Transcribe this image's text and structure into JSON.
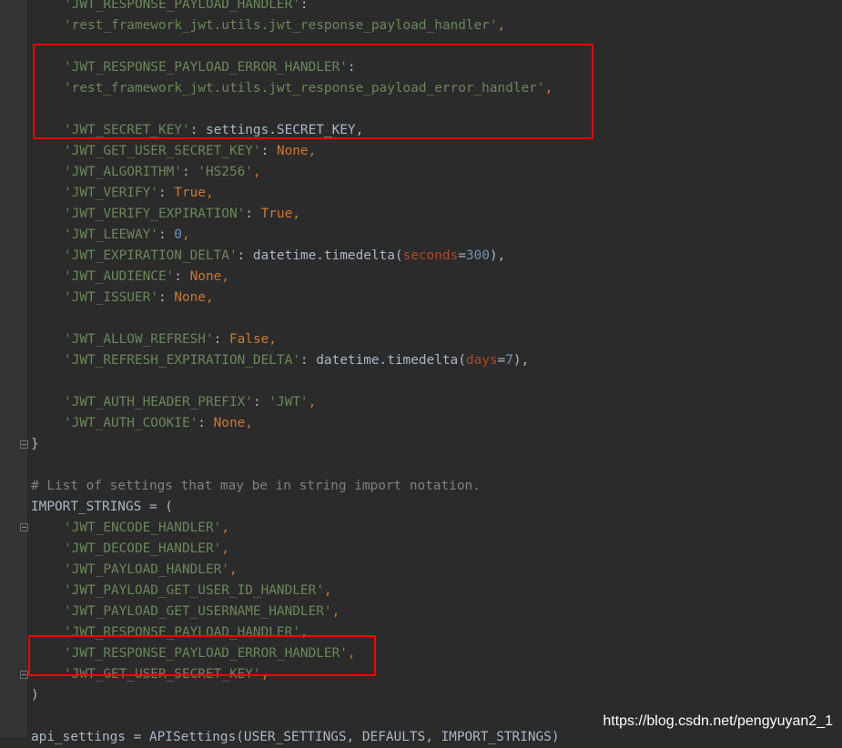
{
  "editor": {
    "colors": {
      "background": "#2b2b2b",
      "string": "#6a8759",
      "keyword": "#cc7832",
      "number": "#6897bb",
      "text": "#a9b7c6",
      "comment": "#808080",
      "param": "#aa4926",
      "highlight": "#ff0000"
    }
  },
  "code": {
    "l1": {
      "key": "'JWT_RESPONSE_PAYLOAD_HANDLER'",
      "rest": ":"
    },
    "l2": {
      "val": "'rest_framework_jwt.utils.jwt_response_payload_handler'",
      "rest": ","
    },
    "l4": {
      "key": "'JWT_RESPONSE_PAYLOAD_ERROR_HANDLER'",
      "rest": ":"
    },
    "l5": {
      "val": "'rest_framework_jwt.utils.jwt_response_payload_error_handler'",
      "rest": ","
    },
    "l7": {
      "key": "'JWT_SECRET_KEY'",
      "rest": ": settings.SECRET_KEY,"
    },
    "l8": {
      "key": "'JWT_GET_USER_SECRET_KEY'",
      "colon": ": ",
      "val": "None",
      "comma": ","
    },
    "l9": {
      "key": "'JWT_ALGORITHM'",
      "colon": ": ",
      "val": "'HS256'",
      "comma": ","
    },
    "l10": {
      "key": "'JWT_VERIFY'",
      "colon": ": ",
      "val": "True",
      "comma": ","
    },
    "l11": {
      "key": "'JWT_VERIFY_EXPIRATION'",
      "colon": ": ",
      "val": "True",
      "comma": ","
    },
    "l12": {
      "key": "'JWT_LEEWAY'",
      "colon": ": ",
      "val": "0",
      "comma": ","
    },
    "l13": {
      "key": "'JWT_EXPIRATION_DELTA'",
      "pre": ": datetime.timedelta(",
      "param": "seconds",
      "eq": "=",
      "num": "300",
      "post": "),"
    },
    "l14": {
      "key": "'JWT_AUDIENCE'",
      "colon": ": ",
      "val": "None",
      "comma": ","
    },
    "l15": {
      "key": "'JWT_ISSUER'",
      "colon": ": ",
      "val": "None",
      "comma": ","
    },
    "l17": {
      "key": "'JWT_ALLOW_REFRESH'",
      "colon": ": ",
      "val": "False",
      "comma": ","
    },
    "l18": {
      "key": "'JWT_REFRESH_EXPIRATION_DELTA'",
      "pre": ": datetime.timedelta(",
      "param": "days",
      "eq": "=",
      "num": "7",
      "post": "),"
    },
    "l20": {
      "key": "'JWT_AUTH_HEADER_PREFIX'",
      "colon": ": ",
      "val": "'JWT'",
      "comma": ","
    },
    "l21": {
      "key": "'JWT_AUTH_COOKIE'",
      "colon": ": ",
      "val": "None",
      "comma": ","
    },
    "l22": {
      "text": "}"
    },
    "l24": {
      "text": "# List of settings that may be in string import notation."
    },
    "l25": {
      "text": "IMPORT_STRINGS = ("
    },
    "l26": {
      "val": "'JWT_ENCODE_HANDLER'",
      "comma": ","
    },
    "l27": {
      "val": "'JWT_DECODE_HANDLER'",
      "comma": ","
    },
    "l28": {
      "val": "'JWT_PAYLOAD_HANDLER'",
      "comma": ","
    },
    "l29": {
      "val": "'JWT_PAYLOAD_GET_USER_ID_HANDLER'",
      "comma": ","
    },
    "l30": {
      "val": "'JWT_PAYLOAD_GET_USERNAME_HANDLER'",
      "comma": ","
    },
    "l31": {
      "val": "'JWT_RESPONSE_PAYLOAD_HANDLER'",
      "comma": ","
    },
    "l32": {
      "val": "'JWT_RESPONSE_PAYLOAD_ERROR_HANDLER'",
      "comma": ","
    },
    "l33": {
      "val": "'JWT_GET_USER_SECRET_KEY'",
      "comma": ","
    },
    "l34": {
      "text": ")"
    },
    "l36": {
      "text": "api_settings = APISettings(USER_SETTINGS, DEFAULTS, IMPORT_STRINGS)"
    }
  },
  "watermark": "https://blog.csdn.net/pengyuyan2_1"
}
